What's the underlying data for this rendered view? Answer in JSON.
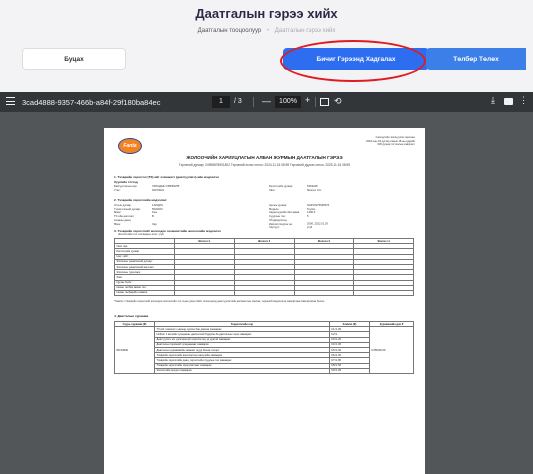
{
  "header": {
    "title": "Даатгалын гэрээ хийх",
    "breadcrumb": [
      "Даатгалын тооцоолуур",
      "Даатгалын гэрээ хийх"
    ]
  },
  "actions": {
    "back_label": "Буцах",
    "save_label": "Бичиг Гэрээнд Хадгалах",
    "pay_label": "Төлбөр Төлөх"
  },
  "pdf_toolbar": {
    "doc_name": "3cad4888-9357-466b-a84f-29f180ba84ec",
    "page_current": "1",
    "page_total": "/ 3",
    "zoom": "100%",
    "zoom_out": "—",
    "zoom_in": "+",
    "rotate_glyph": "⟲",
    "download_glyph": "⤓",
    "more_glyph": "⋮"
  },
  "document": {
    "logo_text": "Fanta",
    "company_address": [
      "Санхүүгийн зохицуулах хорооны",
      "2018 оны 04 дүгээр сарын 18-ны өдрийн",
      "318 дугаар тогтоолын хавсралт"
    ],
    "title": "ЖОЛООЧИЙН ХАРИУЦЛАГЫН АЛБАН ЖУРМЫН ДААТГАЛЫН ГЭРЭЭ",
    "contract_line": "Гэрээний дугаар: 24955878901802   Гэрээний эхлэх огноо: 2024.11.15 08:59   Гэрээний дуусах огноо: 2025.11.15 08:59",
    "section1_title": "1.   Тээврийн хэрэгсэл (ТХ)-ийг эзэмшигч (даатгуулагч)-ийн мэдээлэл",
    "section1_sub": "Хуулийн этгээд",
    "section1_left": [
      [
        "Байгууллагын нэр:",
        "ХЯТАДЫН ХӨРӨНГӨ"
      ],
      [
        "Утас:",
        "94074622"
      ]
    ],
    "section1_right": [
      [
        "Регистрийн дугаар:",
        "5363348"
      ],
      [
        "Хаяг:",
        "Монгол Улс"
      ]
    ],
    "section2_title": "2.   Тээврийн хэрэгслийн мэдээлэл:",
    "section2_left": [
      [
        "Улсын дугаар:",
        "1222ДГА"
      ],
      [
        "Гэрчилгээний дугаар:",
        "5632923"
      ],
      [
        "Марк:",
        "Kea"
      ],
      [
        "ТХ-ийн ангилал:",
        "B"
      ],
      [
        "Ачааны даац:",
        ""
      ],
      [
        "Өнгө:",
        "Хар"
      ]
    ],
    "section2_right": [
      [
        "Арлын дугаар:",
        "NHP10275948376"
      ],
      [
        "Модель:",
        "Toyota"
      ],
      [
        "Хөдөлгүүрийн багтаамж:",
        "1496.0"
      ],
      [
        "Суудлын тоо:",
        "5"
      ],
      [
        "Үйлдвэрлэсэн, Импортлогдсон он:",
        "2006, 2022.01.03"
      ],
      [
        "Чиргүүл:",
        "үгүй"
      ]
    ],
    "section3_title": "3.   Тээврийн хэрэгслийг жолоодох эзэмшигчийн жолоочийн мэдээлэл",
    "section3_sub": "Жолоочийн тоо хязгаарын эсэх: үгүй",
    "driver_headers": [
      "",
      "Жолооч 1",
      "Жолооч 2",
      "Жолооч 3",
      "Жолооч 4"
    ],
    "driver_rows": [
      "Овог нэр:",
      "Регистрийн дугаар:",
      "Нас, хүйс:",
      "Жолооны үнэмлэхний дугаар:",
      "Жолооны үнэмлэхний ангилал:",
      "Жолооны туршлага:",
      "Хаяг:",
      "Цусны бүлэг:",
      "Нөхөн төлбөр авсан тоо:",
      "Нөхөн төлбөрийн хэмжээ:"
    ],
    "note": "*Хэвлэгч Тээврийн хэрэгслийг жолоодох жолоочийн тоо 4-өөс дээш байх тохиолдолд даатгуулагчийн жагсаалтын хэвлэж, гэрээний мэдээлэлд хавсаргана Хавсаргасан болно.",
    "section4_title": "4.   Даатгалын хураамж",
    "premium_headers": [
      "Суурь хураамж (₮)",
      "Үндэслэлийн нэр",
      "Хэмжээ (₮)",
      "Хураамжийн дүн ₮"
    ],
    "premium_base": "80=33000",
    "premium_total": "К=89100.00",
    "premium_rows": [
      [
        "ТХ-ийг эзэмшигч насанд хүрсэн бие даасан хамаарах",
        "К1=1.00"
      ],
      [
        "Нийлэг 1 жилийн хугацааны даатгалтай бүрдсэн ба даатгалын гэрээ хамаарах",
        "К2=1"
      ],
      [
        "Даатгуулагч нэг дэлгэрэнгүй хэрэглэгчид үр дүнтэй хамаарах",
        "К3=1.20"
      ],
      [
        "Даатгалын гэрээний хугацаанаас хамаарах",
        "К4=1.00"
      ],
      [
        "Даатгалын хураамжийн хэмжээг шууд бичиж тооцох",
        "К5=1.00"
      ],
      [
        "Тээврийн хэрэгслийн ашиглалтын нөхцлийн хамаарах",
        "К6=1.00"
      ],
      [
        "Тээврийн хэрэгслийн даац, зорчигчийн суудлын тоо хамаарах",
        "К7=1.80"
      ],
      [
        "Тээврийн хэрэгслийн зориулалтаас хамаарах",
        "К8=1.50"
      ],
      [
        "Жолоочийн эрсдэл хамаарах",
        "К9=1.00"
      ]
    ]
  }
}
